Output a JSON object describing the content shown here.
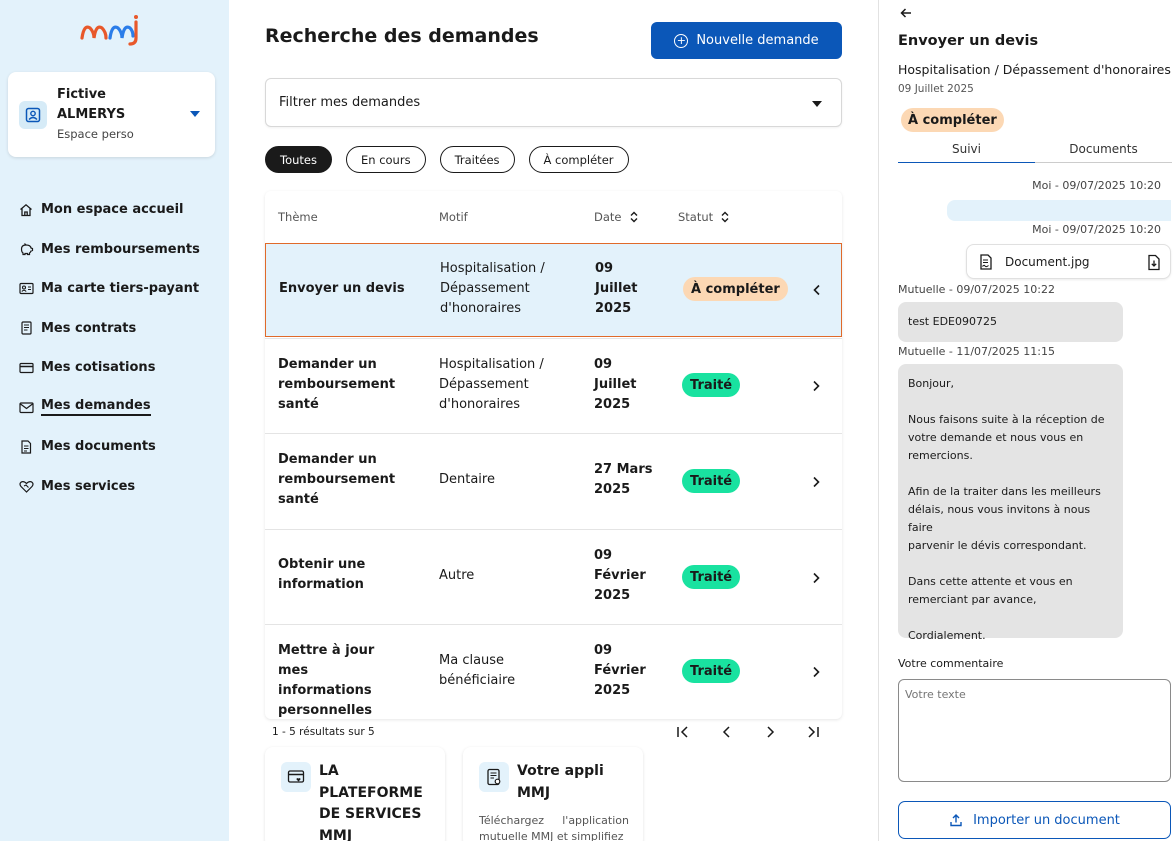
{
  "sidebar": {
    "logo_text": "mmj",
    "profile": {
      "name_line1": "Fictive",
      "name_line2": "ALMERYS",
      "subtitle": "Espace perso"
    },
    "nav": [
      {
        "label": "Mon espace accueil",
        "icon": "home-icon"
      },
      {
        "label": "Mes remboursements",
        "icon": "piggy-bank-icon"
      },
      {
        "label": "Ma carte tiers-payant",
        "icon": "id-card-icon"
      },
      {
        "label": "Mes contrats",
        "icon": "contract-icon"
      },
      {
        "label": "Mes cotisations",
        "icon": "credit-card-icon"
      },
      {
        "label": "Mes demandes",
        "icon": "mail-icon",
        "active": true
      },
      {
        "label": "Mes documents",
        "icon": "document-icon"
      },
      {
        "label": "Mes services",
        "icon": "heart-handshake-icon"
      }
    ]
  },
  "main": {
    "title": "Recherche des demandes",
    "new_button": "Nouvelle demande",
    "filter_label": "Filtrer mes demandes",
    "chips": [
      "Toutes",
      "En cours",
      "Traitées",
      "À compléter"
    ],
    "table": {
      "headers": {
        "theme": "Thème",
        "motif": "Motif",
        "date": "Date",
        "statut": "Statut"
      },
      "rows": [
        {
          "theme": "Envoyer un devis",
          "motif": "Hospitalisation / Dépassement d'honoraires",
          "date": "09 Juillet 2025",
          "status": "À compléter",
          "status_kind": "todo",
          "selected": true
        },
        {
          "theme": "Demander un remboursement santé",
          "motif": "Hospitalisation / Dépassement d'honoraires",
          "date": "09 Juillet 2025",
          "status": "Traité",
          "status_kind": "done"
        },
        {
          "theme": "Demander un remboursement santé",
          "motif": "Dentaire",
          "date": "27 Mars 2025",
          "status": "Traité",
          "status_kind": "done"
        },
        {
          "theme": "Obtenir une information",
          "motif": "Autre",
          "date": "09 Février 2025",
          "status": "Traité",
          "status_kind": "done"
        },
        {
          "theme": "Mettre à jour mes informations personnelles",
          "motif": "Ma clause bénéficiaire",
          "date": "09 Février 2025",
          "status": "Traité",
          "status_kind": "done"
        }
      ]
    },
    "pagination_text": "1 - 5 résultats sur 5",
    "promos": [
      {
        "title": "LA PLATEFORME DE SERVICES MMJ",
        "text": "",
        "icon": "card-heart-icon"
      },
      {
        "title": "Votre appli MMJ",
        "text": "Téléchargez l'application mutuelle MMJ et simplifiez",
        "icon": "phone-doc-icon"
      }
    ]
  },
  "panel": {
    "title": "Envoyer un devis",
    "subtitle": "Hospitalisation / Dépassement d'honoraires",
    "date": "09 Juillet 2025",
    "status": "À compléter",
    "tabs": [
      "Suivi",
      "Documents"
    ],
    "messages": {
      "me1_meta": "Moi - 09/07/2025 10:20",
      "me2_meta": "Moi - 09/07/2025 10:20",
      "attachment": "Document.jpg",
      "mutuelle1_meta": "Mutuelle - 09/07/2025 10:22",
      "mutuelle1_text": "test EDE090725",
      "mutuelle2_meta": "Mutuelle - 11/07/2025 11:15",
      "mutuelle2_lines": [
        "Bonjour,",
        "",
        "Nous faisons suite à la réception de",
        "votre demande et nous vous en",
        "remercions.",
        "",
        "Afin de la traiter dans les meilleurs",
        "délais, nous vous invitons à nous faire",
        "parvenir le dévis correspondant.",
        "",
        "Dans cette attente et vous en",
        "remerciant par avance,",
        "",
        "Cordialement."
      ]
    },
    "comment_label": "Votre commentaire",
    "comment_placeholder": "Votre texte",
    "import_button": "Importer un document"
  },
  "colors": {
    "primary": "#0b57b8",
    "sidebar_bg": "#e3f2fb",
    "todo": "#fcd8b4",
    "done": "#19e2a0",
    "selected_border": "#e06a2a"
  }
}
